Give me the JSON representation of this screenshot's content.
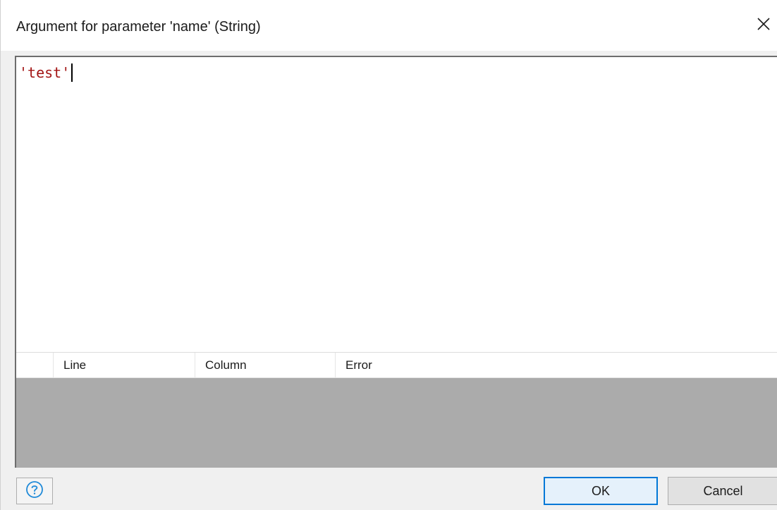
{
  "dialog": {
    "title": "Argument for parameter 'name' (String)",
    "close_icon": "close-icon"
  },
  "editor": {
    "code": "'test'",
    "string_color": "#a31515"
  },
  "errors_table": {
    "columns": [
      "",
      "Line",
      "Column",
      "Error"
    ],
    "rows": []
  },
  "footer": {
    "help_icon": "question-circle-icon",
    "ok_label": "OK",
    "cancel_label": "Cancel",
    "accent_color": "#0078d7"
  }
}
